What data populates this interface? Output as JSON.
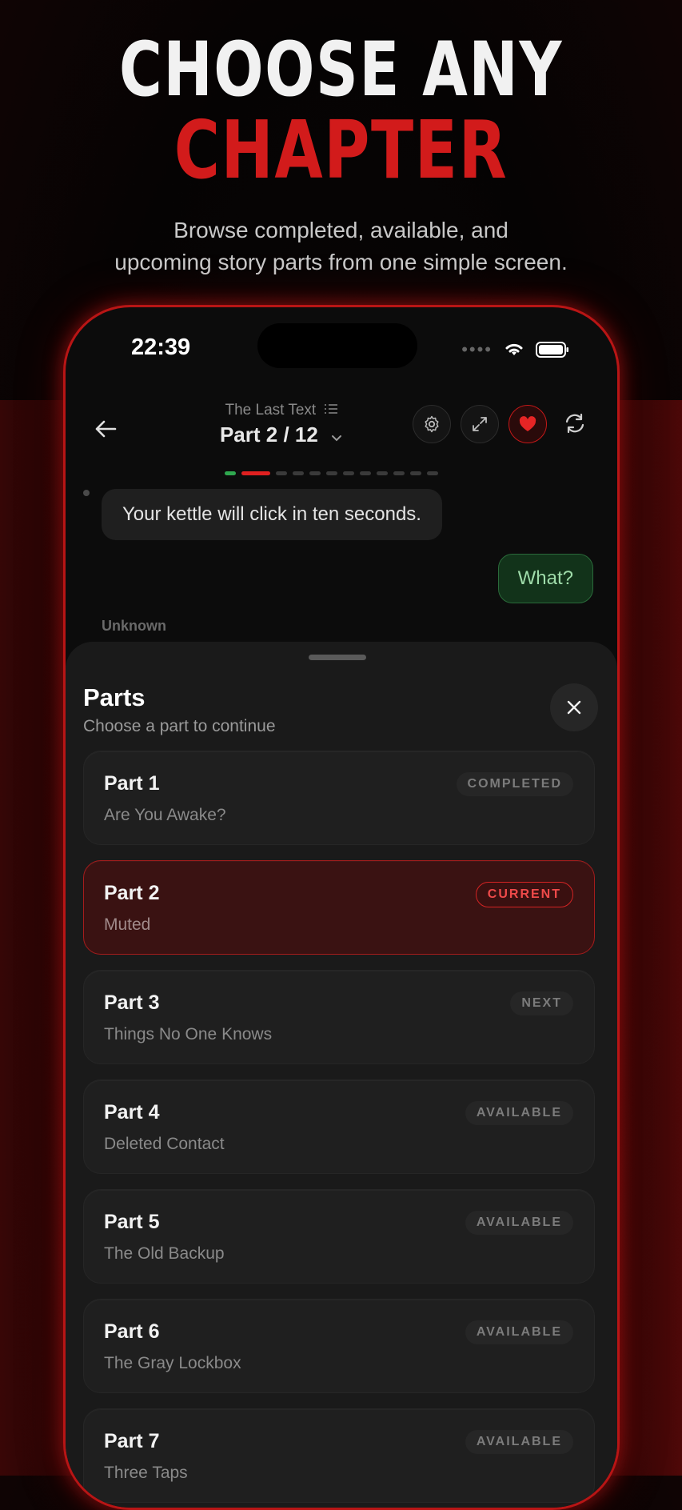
{
  "headline": {
    "line1": "CHOOSE ANY",
    "line2": "CHAPTER",
    "subtitle_1": "Browse completed, available, and",
    "subtitle_2": "upcoming story parts from one simple screen."
  },
  "status_bar": {
    "time": "22:39"
  },
  "nav": {
    "story_title": "The Last Text",
    "part_indicator": "Part 2 / 12"
  },
  "progress": {
    "total_parts": 12,
    "completed": 1,
    "current": 2
  },
  "chat": {
    "incoming": "Your kettle will click in ten seconds.",
    "outgoing": "What?",
    "sender_label": "Unknown"
  },
  "sheet": {
    "title": "Parts",
    "subtitle": "Choose a part to continue",
    "parts": [
      {
        "name": "Part 1",
        "desc": "Are You Awake?",
        "badge": "COMPLETED",
        "state": "completed"
      },
      {
        "name": "Part 2",
        "desc": "Muted",
        "badge": "CURRENT",
        "state": "current"
      },
      {
        "name": "Part 3",
        "desc": "Things No One Knows",
        "badge": "NEXT",
        "state": "next"
      },
      {
        "name": "Part 4",
        "desc": "Deleted Contact",
        "badge": "AVAILABLE",
        "state": "available"
      },
      {
        "name": "Part 5",
        "desc": "The Old Backup",
        "badge": "AVAILABLE",
        "state": "available"
      },
      {
        "name": "Part 6",
        "desc": "The Gray Lockbox",
        "badge": "AVAILABLE",
        "state": "available"
      },
      {
        "name": "Part 7",
        "desc": "Three Taps",
        "badge": "AVAILABLE",
        "state": "available"
      }
    ]
  },
  "colors": {
    "accent_red": "#d21b1b",
    "success_green": "#2fa84f"
  }
}
